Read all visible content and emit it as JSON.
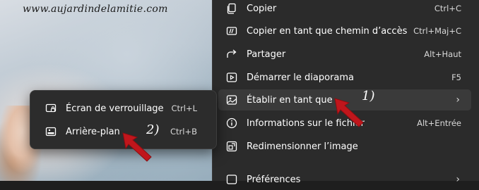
{
  "watermark": "www.aujardindelamitie.com",
  "context_menu": {
    "items": [
      {
        "label": "Copier",
        "shortcut": "Ctrl+C",
        "icon": "copy-icon"
      },
      {
        "label": "Copier en tant que chemin d’accès",
        "shortcut": "Ctrl+Maj+C",
        "icon": "copy-path-icon"
      },
      {
        "label": "Partager",
        "shortcut": "Alt+Haut",
        "icon": "share-icon"
      },
      {
        "label": "Démarrer le diaporama",
        "shortcut": "F5",
        "icon": "slideshow-icon"
      },
      {
        "label": "Établir en tant que",
        "shortcut": "",
        "icon": "set-as-icon",
        "has_submenu": true
      },
      {
        "label": "Informations sur le fichier",
        "shortcut": "Alt+Entrée",
        "icon": "info-icon"
      },
      {
        "label": "Redimensionner l’image",
        "shortcut": "",
        "icon": "resize-icon"
      },
      {
        "label": "Préférences",
        "shortcut": "",
        "icon": "preferences-icon",
        "has_submenu": true
      }
    ]
  },
  "submenu": {
    "items": [
      {
        "label": "Écran de verrouillage",
        "shortcut": "Ctrl+L",
        "icon": "lock-screen-icon"
      },
      {
        "label": "Arrière-plan",
        "shortcut": "Ctrl+B",
        "icon": "wallpaper-icon"
      }
    ]
  },
  "annotations": {
    "step1": "1)",
    "step2": "2)"
  },
  "colors": {
    "menu_bg": "#2b2b2b",
    "hover_bg": "#3a3a3a",
    "arrow": "#c0161c"
  }
}
